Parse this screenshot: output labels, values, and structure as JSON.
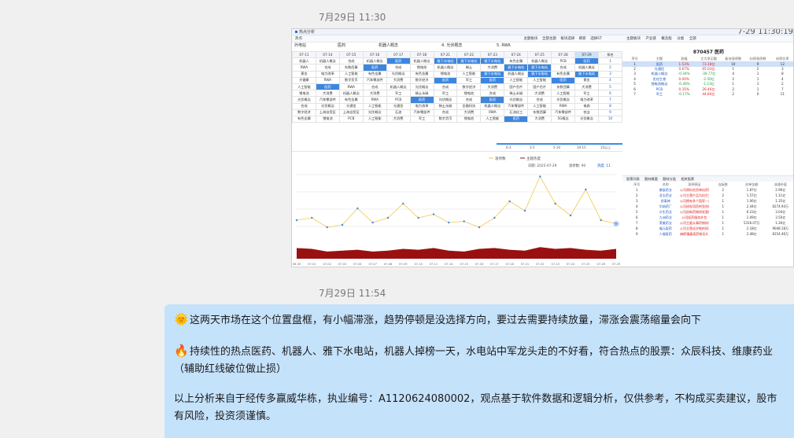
{
  "chat": {
    "timestamp_top": "7月29日 11:30",
    "timestamp_bottom": "7月29日 11:54"
  },
  "screenshot": {
    "window_title": "热点分析",
    "time": "7-29 11:30:19",
    "toolbar": [
      "热点",
      "主题板块",
      "全部主题",
      "板块选择",
      "刷新",
      "选择ST"
    ],
    "tabs": [
      "外电站",
      "医药",
      "机器人概念",
      "4. 光伏概念",
      "5. RWA"
    ],
    "grid": {
      "dates": [
        "07-11",
        "07-14",
        "07-15",
        "07-16",
        "07-17",
        "07-18",
        "07-21",
        "07-22",
        "07-23",
        "07-24",
        "07-25",
        "07-28",
        "07-29"
      ],
      "rank_header": "排名",
      "rows": [
        [
          "机器人",
          "机器人概念",
          "合成",
          "机器人概念",
          "医药",
          "机器人概念",
          "雅下水电站",
          "雅下水电站",
          "雅下水电站",
          "有色金属",
          "机器人概念",
          "PCB",
          "医药"
        ],
        [
          "RWA",
          "合成",
          "东数西算",
          "医药",
          "合成",
          "锂电池",
          "机器人概念",
          "稀土",
          "大消费",
          "雅下水电站",
          "雅下水电站",
          "合成",
          "机器人概念"
        ],
        [
          "黄金",
          "电力改革",
          "人工智能",
          "有色金属",
          "光伏概念",
          "有色金属",
          "锂电池",
          "人工智能",
          "雅下水电站",
          "机器人概念",
          "雅下水电站",
          "有色金属",
          "雅下水电站"
        ],
        [
          "大健康",
          "RWA",
          "数字货币",
          "汽车零部件",
          "大消费",
          "数字经济",
          "医药",
          "军工",
          "医药",
          "人工智能",
          "人工智能",
          "医药",
          "黄金"
        ],
        [
          "人工智能",
          "医药",
          "RWA",
          "合成",
          "机器人概念",
          "光伏概念",
          "合成",
          "数字经济",
          "大消费",
          "国产芯片",
          "国产芯片",
          "东数西算",
          "大消费"
        ],
        [
          "锂电池",
          "大消费",
          "机器人概念",
          "大消费",
          "军工",
          "稀土永磁",
          "军工",
          "锂电池",
          "合成",
          "稀土永磁",
          "大消费",
          "人工智能",
          "军工"
        ],
        [
          "光伏概念",
          "汽车零部件",
          "有色金属",
          "RWA",
          "PCB",
          "医药",
          "光伏概念",
          "合成",
          "医药",
          "光伏概念",
          "合成",
          "光伏概念",
          "电力改革"
        ],
        [
          "合成",
          "光伏概念",
          "光通信",
          "人工智能",
          "光通信",
          "电力改革",
          "稀土永磁",
          "金融科技",
          "机器人概念",
          "汽车零部件",
          "人工智能",
          "RWA",
          "电商"
        ],
        [
          "数字经济",
          "上海自贸区",
          "上海自贸区",
          "光伏概念",
          "石油",
          "汽车零部件",
          "合成",
          "大消费",
          "RWA",
          "石油化工",
          "东数西算",
          "汽车零部件",
          "农业"
        ],
        [
          "有色金属",
          "锂电池",
          "PCB",
          "人工智能",
          "大消费",
          "军工",
          "数字货币",
          "锂电池",
          "人工智能",
          "医药",
          "大消费",
          "5G概念",
          "光伏概念"
        ]
      ],
      "ranks": [
        "1",
        "2",
        "3",
        "4",
        "5",
        "6",
        "7",
        "8",
        "9",
        "10"
      ]
    },
    "range_labels": [
      "0-3",
      "3-5",
      "5-10",
      "10-15",
      "15以上"
    ],
    "chart": {
      "legend": [
        "涨停数",
        "主题热度"
      ],
      "info_date": "日期: 2025-07-29",
      "info_count": "涨停数: 90",
      "info_heat": "热度: 11",
      "x_labels": [
        "06-30",
        "07-01",
        "07-02",
        "07-03",
        "07-04",
        "07-07",
        "07-08",
        "07-09",
        "07-10",
        "07-11",
        "07-14",
        "07-15",
        "07-16",
        "07-17",
        "07-18",
        "07-21",
        "07-22",
        "07-23",
        "07-24",
        "07-25",
        "07-28",
        "07-29"
      ]
    },
    "chart_data": {
      "type": "line",
      "x": [
        "06-30",
        "07-01",
        "07-02",
        "07-03",
        "07-04",
        "07-07",
        "07-08",
        "07-09",
        "07-10",
        "07-11",
        "07-14",
        "07-15",
        "07-16",
        "07-17",
        "07-18",
        "07-21",
        "07-22",
        "07-23",
        "07-24",
        "07-25",
        "07-28",
        "07-29"
      ],
      "series": [
        {
          "name": "涨停数",
          "values": [
            58,
            60,
            52,
            54,
            68,
            56,
            60,
            72,
            60,
            63,
            56,
            57,
            52,
            60,
            74,
            66,
            95,
            72,
            62,
            84,
            58,
            55
          ],
          "color": "#f2c84b"
        },
        {
          "name": "主题热度",
          "values": [
            12,
            11,
            8,
            9,
            10,
            8,
            9,
            11,
            10,
            12,
            9,
            8,
            11,
            12,
            10,
            9,
            13,
            11,
            12,
            10,
            9,
            11
          ],
          "color": "#9a1010"
        }
      ]
    },
    "right_panel": {
      "tabs": [
        "主题板块",
        "产业链",
        "概念股",
        "分类",
        "全部"
      ],
      "title": "870457 医药",
      "headers": [
        "序号",
        "主题",
        "涨幅",
        "主力净买额",
        "板块涨停数",
        "封停涨停数",
        "封停比率"
      ],
      "rows": [
        [
          "1",
          "医药",
          "1.53%",
          "73.18亿",
          "10",
          "9",
          "12"
        ],
        [
          "2",
          "光通信",
          "0.67%",
          "65.03亿",
          "1",
          "2",
          "3"
        ],
        [
          "3",
          "机器人概念",
          "-0.34%",
          "-39.77亿",
          "4",
          "1",
          "8"
        ],
        [
          "4",
          "优化生育",
          "0.00%",
          "-2.50亿",
          "2",
          "1",
          "4"
        ],
        [
          "5",
          "锂电池概念",
          "-0.36%",
          "-1.13亿",
          "1",
          "1",
          "2"
        ],
        [
          "6",
          "PCB",
          "0.35%",
          "26.46亿",
          "2",
          "1",
          "7"
        ],
        [
          "7",
          "军工",
          "-0.17%",
          "44.84亿",
          "2",
          "0",
          "11"
        ]
      ]
    },
    "stock_panel": {
      "tabs": [
        "股票列表",
        "题材概要",
        "题材分类",
        "相关股票"
      ],
      "headers": [
        "序号",
        "名称",
        "涨停原因",
        "连板数",
        "封单金额",
        "流通市值"
      ],
      "rows": [
        [
          "1",
          "康辰药业",
          "公司原料合资单抗药物",
          "2",
          "1.87亿",
          "2.96亿"
        ],
        [
          "2",
          "亚太药业",
          "公司主营产品为抗生素",
          "2",
          "1.57亿",
          "1.11亿"
        ],
        [
          "3",
          "舒泰神",
          "公司拥有多个国家一类新药",
          "1",
          "1.06亿",
          "1.35亿"
        ],
        [
          "4",
          "华纳药厂",
          "公司研发用药剂型创新",
          "1",
          "2.44亿",
          "6274.94万"
        ],
        [
          "5",
          "众生药业",
          "公司创新药物研发管线",
          "1",
          "6.23亿",
          "3.04亿"
        ],
        [
          "6",
          "九洲药业",
          "公司医药服务外包",
          "1",
          "1.09亿",
          "3.50亿"
        ],
        [
          "7",
          "莱美药业",
          "公司主要从事药物研发",
          "1",
          "5316.07万",
          "1.26亿"
        ],
        [
          "8",
          "福元医药",
          "公司主营化学制剂研发",
          "1",
          "2.18亿",
          "9048.18万"
        ],
        [
          "9",
          "人福医药",
          "麻醉镇痛类药物龙头",
          "1",
          "2.48亿",
          "8154.46万"
        ]
      ]
    }
  },
  "message": {
    "emoji1": "🌞",
    "para1": "这两天市场在这个位置盘框，有小幅滞涨，趋势停顿是没选择方向，要过去需要持续放量，滞涨会震荡缩量会向下",
    "emoji2": "🔥",
    "para2": "持续性的热点医药、机器人、雅下水电站，机器人掉榜一天，水电站中军龙头走的不好看，符合热点的股票：众辰科技、维康药业（辅助红线破位做止损）",
    "para3": "以上分析来自于经传多赢威华栋，执业编号：A1120624080002，观点基于软件数据和逻辑分析，仅供参考，不构成买卖建议，股市有风险，投资须谨慎。"
  }
}
